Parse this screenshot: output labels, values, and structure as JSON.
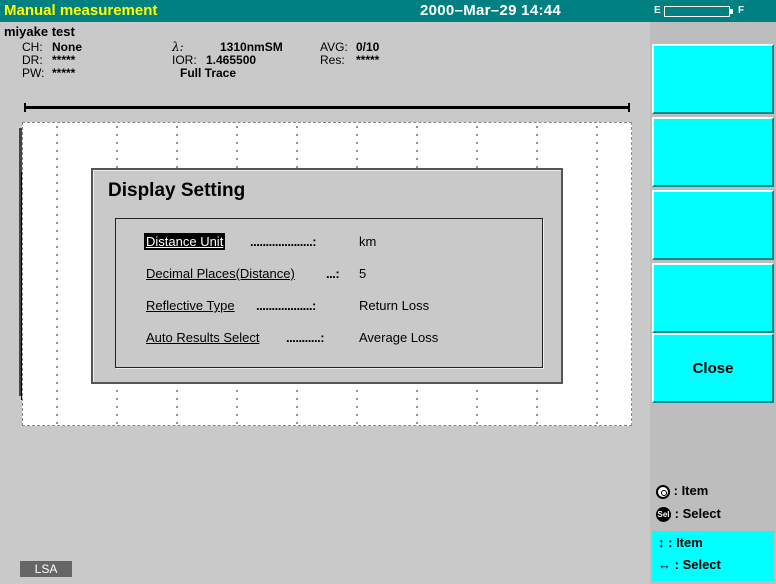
{
  "titlebar": {
    "title": "Manual measurement",
    "datetime": "2000–Mar–29 14:44",
    "battery_empty": "E",
    "battery_full": "F"
  },
  "info": {
    "test_name": "miyake test",
    "ch_label": "CH:",
    "ch_value": "None",
    "dr_label": "DR:",
    "dr_value": "*****",
    "pw_label": "PW:",
    "pw_value": "*****",
    "wavelength_label": "λ:",
    "wavelength_value": "1310nmSM",
    "ior_label": "IOR:",
    "ior_value": "1.465500",
    "trace_value": "Full Trace",
    "avg_label": "AVG:",
    "avg_value": "0/10",
    "res_label": "Res:",
    "res_value": "*****"
  },
  "dialog": {
    "title": "Display Setting",
    "rows": [
      {
        "label": "Distance Unit",
        "dots": "....................:",
        "value": "km"
      },
      {
        "label": "Decimal Places(Distance)",
        "dots": "...:",
        "value": "5"
      },
      {
        "label": "Reflective Type",
        "dots": "..................:",
        "value": "Return Loss"
      },
      {
        "label": "Auto Results Select",
        "dots": "...........:",
        "value": "Average Loss"
      }
    ]
  },
  "softkeys": {
    "key5_label": "Close"
  },
  "legend": {
    "knob_text": ": Item",
    "sel_icon_text": "Sel",
    "sel_text": ": Select",
    "updown_arrow": "↕",
    "updown_text": ": Item",
    "leftright_arrow": "↔",
    "leftright_text": ": Select"
  },
  "status": {
    "lsa": "LSA"
  },
  "colors": {
    "titlebar": "#008080",
    "title_text": "#ffff00",
    "softkey": "#00ffff",
    "background": "#c9c9c9"
  }
}
